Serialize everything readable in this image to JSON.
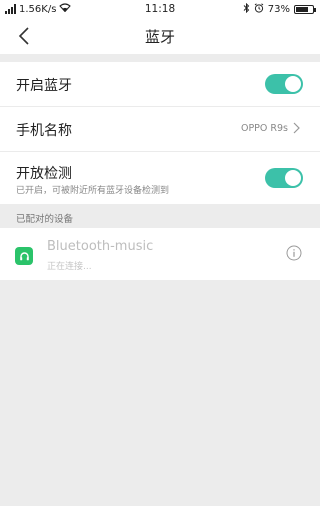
{
  "status_bar": {
    "speed": "1.56K/s",
    "time": "11:18",
    "battery": "73%",
    "battery_level": 0.73,
    "icons": [
      "signal-icon",
      "wifi-icon",
      "bluetooth-icon",
      "alarm-icon",
      "battery-icon"
    ]
  },
  "header": {
    "title": "蓝牙",
    "back_icon": "back-arrow-icon"
  },
  "settings": {
    "bluetooth_label": "开启蓝牙",
    "bluetooth_on": true,
    "device_name_label": "手机名称",
    "device_name_value": "OPPO R9s",
    "discoverable_label": "开放检测",
    "discoverable_sub": "已开启，可被附近所有蓝牙设备检测到",
    "discoverable_on": true
  },
  "paired": {
    "section_title": "已配对的设备",
    "devices": [
      {
        "name": "Bluetooth-music",
        "status": "正在连接...",
        "icon": "headset-icon"
      }
    ]
  },
  "colors": {
    "accent": "#3cc1a9",
    "device_icon_bg": "#2bc36a",
    "background": "#ececec"
  }
}
